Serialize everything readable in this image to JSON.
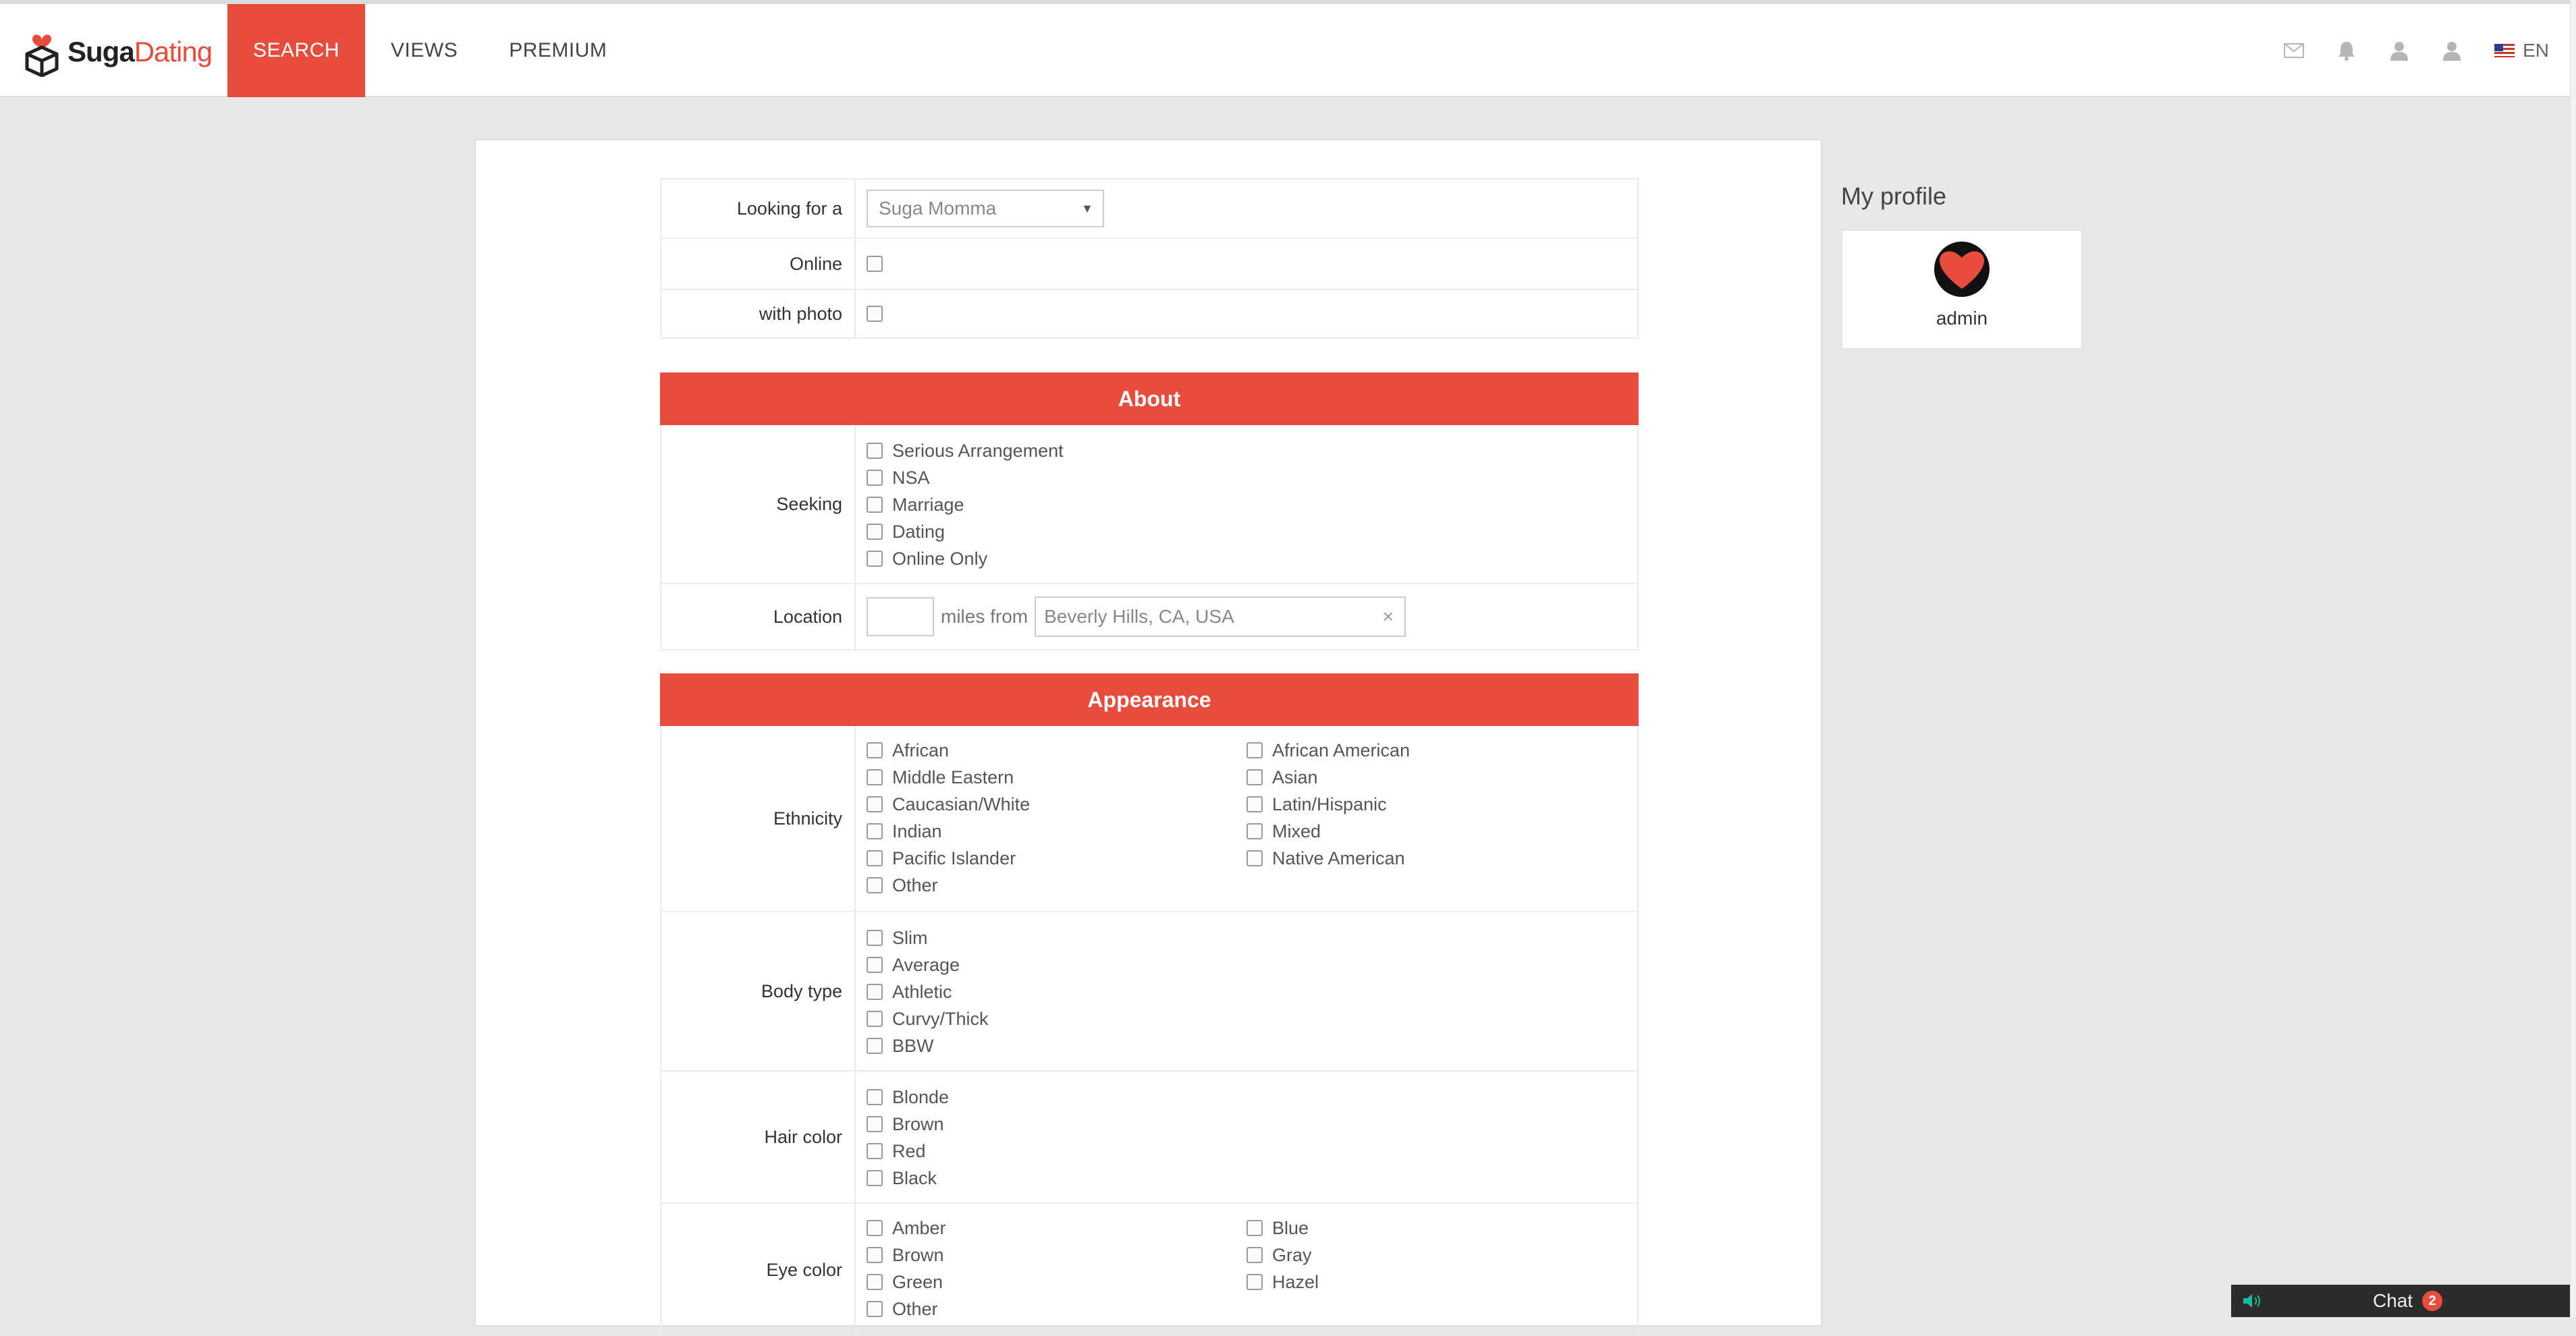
{
  "header": {
    "logo": {
      "part1": "Suga",
      "part2": "Dating"
    },
    "nav": [
      {
        "label": "SEARCH",
        "active": true
      },
      {
        "label": "VIEWS",
        "active": false
      },
      {
        "label": "PREMIUM",
        "active": false
      }
    ],
    "icons": [
      "mail-icon",
      "bell-icon",
      "user-icon",
      "user-icon"
    ],
    "language": "EN"
  },
  "search": {
    "looking_for_label": "Looking for a",
    "looking_for_value": "Suga Momma",
    "online_label": "Online",
    "photo_label": "with photo"
  },
  "about": {
    "title": "About",
    "seeking_label": "Seeking",
    "seeking_options": [
      "Serious Arrangement",
      "NSA",
      "Marriage",
      "Dating",
      "Online Only"
    ],
    "location_label": "Location",
    "miles_from": "miles from",
    "location_value": "Beverly Hills, CA, USA"
  },
  "appearance": {
    "title": "Appearance",
    "ethnicity_label": "Ethnicity",
    "ethnicity_options": [
      "African",
      "African American",
      "Middle Eastern",
      "Asian",
      "Caucasian/White",
      "Latin/Hispanic",
      "Indian",
      "Mixed",
      "Pacific Islander",
      "Native American",
      "Other"
    ],
    "body_label": "Body type",
    "body_options": [
      "Slim",
      "Average",
      "Athletic",
      "Curvy/Thick",
      "BBW"
    ],
    "hair_label": "Hair color",
    "hair_options": [
      "Blonde",
      "Brown",
      "Red",
      "Black"
    ],
    "eye_label": "Eye color",
    "eye_options": [
      "Amber",
      "Blue",
      "Brown",
      "Gray",
      "Green",
      "Hazel",
      "Other"
    ]
  },
  "sidebar": {
    "title": "My profile",
    "username": "admin"
  },
  "chat": {
    "label": "Chat",
    "count": "2"
  },
  "colors": {
    "accent": "#e74c3c",
    "background": "#e8e8e8"
  }
}
